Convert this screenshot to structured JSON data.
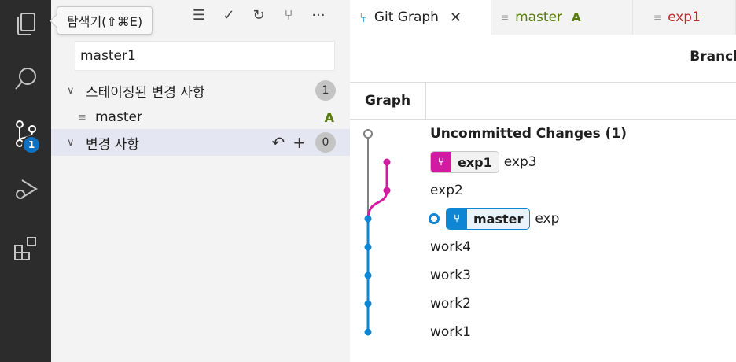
{
  "activity_bar": {
    "icons": [
      "explorer-icon",
      "search-icon",
      "source-control-icon",
      "run-debug-icon",
      "extensions-icon"
    ],
    "scm_badge": "1"
  },
  "tooltip": {
    "text": "탐색기(⇧⌘E)"
  },
  "sidebar": {
    "toolbar": [
      "view-tree-icon",
      "commit-check-icon",
      "refresh-icon",
      "git-graph-icon",
      "more-icon"
    ],
    "commit_message": "master1",
    "staged": {
      "label": "스테이징된 변경 사항",
      "count": "1"
    },
    "staged_file": {
      "name": "master",
      "status": "A"
    },
    "changes": {
      "label": "변경 사항",
      "count": "0"
    }
  },
  "tabs": [
    {
      "label": "Git Graph",
      "active": true
    },
    {
      "label": "master",
      "badge": "A"
    },
    {
      "label": "exp1"
    }
  ],
  "graph": {
    "branches_header": "Branches",
    "column_header": "Graph",
    "commits": [
      {
        "message": "Uncommitted Changes (1)"
      },
      {
        "ref": "exp1",
        "message": "exp3"
      },
      {
        "message": "exp2"
      },
      {
        "ref": "master",
        "message": "exp"
      },
      {
        "message": "work4"
      },
      {
        "message": "work3"
      },
      {
        "message": "work2"
      },
      {
        "message": "work1"
      }
    ],
    "colors": {
      "blue": "#0e86d4",
      "magenta": "#d11ba1",
      "gray": "#808080"
    }
  }
}
